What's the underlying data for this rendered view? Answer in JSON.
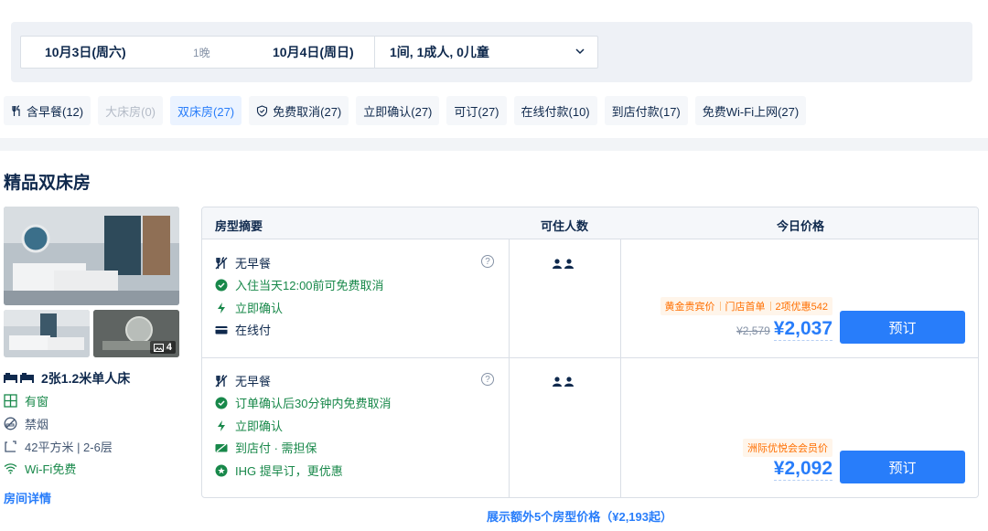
{
  "search": {
    "checkin": "10月3日(周六)",
    "nights": "1晚",
    "checkout": "10月4日(周日)",
    "guests": "1间, 1成人, 0儿童"
  },
  "filters": [
    {
      "label": "含早餐(12)",
      "state": "normal",
      "icon": "utensils-icon"
    },
    {
      "label": "大床房(0)",
      "state": "disabled"
    },
    {
      "label": "双床房(27)",
      "state": "active"
    },
    {
      "label": "免费取消(27)",
      "state": "normal",
      "icon": "shield-check-icon"
    },
    {
      "label": "立即确认(27)",
      "state": "normal"
    },
    {
      "label": "可订(27)",
      "state": "normal"
    },
    {
      "label": "在线付款(10)",
      "state": "normal"
    },
    {
      "label": "到店付款(17)",
      "state": "normal"
    },
    {
      "label": "免费Wi-Fi上网(27)",
      "state": "normal"
    }
  ],
  "room": {
    "title": "精品双床房",
    "photo_count": "4",
    "bed": "2张1.2米单人床",
    "window": "有窗",
    "smoking": "禁烟",
    "size_floor": "42平方米 | 2-6层",
    "wifi": "Wi-Fi免费",
    "detail_link": "房间详情"
  },
  "table": {
    "headers": [
      "房型摘要",
      "可住人数",
      "今日价格"
    ],
    "rows": [
      {
        "meal": "无早餐",
        "cancel": "入住当天12:00前可免费取消",
        "confirm": "立即确认",
        "pay": "在线付",
        "tags": [
          "黄金贵宾价",
          "门店首单",
          "2项优惠542"
        ],
        "original_price": "¥2,579",
        "price": "¥2,037",
        "button": "预订"
      },
      {
        "meal": "无早餐",
        "cancel": "订单确认后30分钟内免费取消",
        "confirm": "立即确认",
        "pay": "到店付 · 需担保",
        "promo": "IHG 提早订，更优惠",
        "tags": [
          "洲际优悦会会员价"
        ],
        "price": "¥2,092",
        "button": "预订"
      }
    ]
  },
  "more_link": "展示额外5个房型价格（¥2,193起）",
  "colors": {
    "primary": "#287dfa",
    "green": "#18884a",
    "orange": "#ff6f00",
    "text": "#0f294d"
  }
}
